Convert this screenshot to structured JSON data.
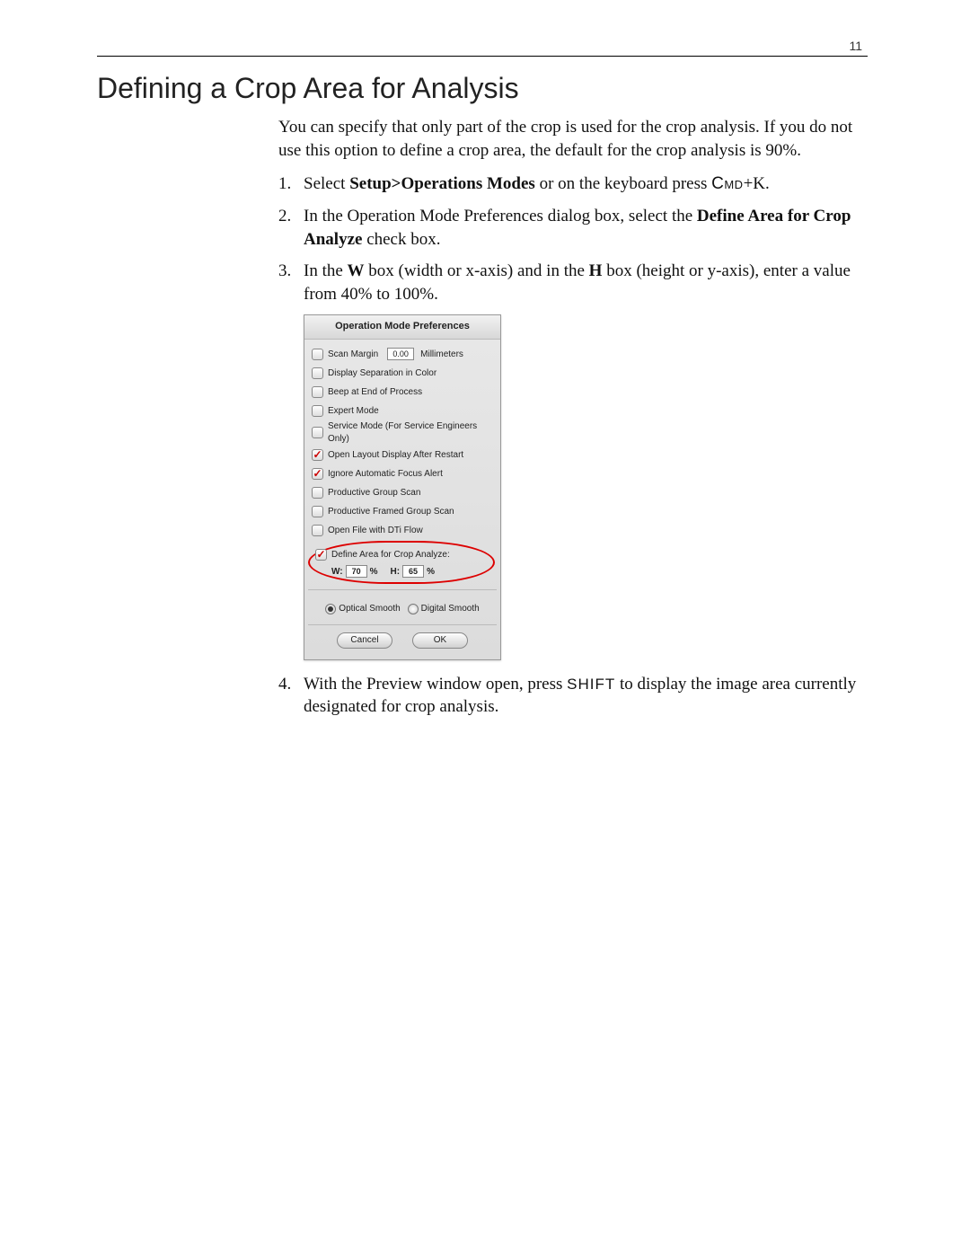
{
  "page_number": "11",
  "heading": "Defining a Crop Area for Analysis",
  "intro": "You can specify that only part of the crop is used for the crop analysis. If you do not use this option to define a crop area, the default for the crop analysis is 90%.",
  "steps": {
    "s1": {
      "num": "1.",
      "pre": "Select ",
      "bold": "Setup>Operations Modes",
      "mid": " or on the keyboard press ",
      "cmd": "Cmd",
      "post": "+K."
    },
    "s2": {
      "num": "2.",
      "pre": "In the Operation Mode Preferences dialog box, select the ",
      "bold": "Define Area for Crop Analyze",
      "post": " check box."
    },
    "s3": {
      "num": "3.",
      "pre": "In the ",
      "b1": "W",
      "mid1": " box (width or x-axis) and in the ",
      "b2": "H",
      "mid2": " box (height or y-axis), enter a value from 40% to 100%."
    },
    "s4": {
      "num": "4.",
      "pre": "With the Preview window open, press ",
      "shift": "SHIFT",
      "post": " to display the image area currently designated for crop analysis."
    }
  },
  "dialog": {
    "title": "Operation Mode Preferences",
    "scan_margin_label": "Scan Margin",
    "scan_margin_value": "0.00",
    "scan_margin_unit": "Millimeters",
    "display_separation": "Display Separation in Color",
    "beep": "Beep at End of Process",
    "expert": "Expert Mode",
    "service": "Service Mode (For Service Engineers Only)",
    "open_layout": "Open Layout Display After Restart",
    "ignore_focus": "Ignore Automatic Focus Alert",
    "productive_group": "Productive Group Scan",
    "productive_framed": "Productive Framed Group Scan",
    "open_dti": "Open File with DTi Flow",
    "define_area": "Define Area for Crop Analyze:",
    "w_label": "W:",
    "w_value": "70",
    "h_label": "H:",
    "h_value": "65",
    "percent": "%",
    "optical": "Optical Smooth",
    "digital": "Digital Smooth",
    "cancel": "Cancel",
    "ok": "OK"
  }
}
